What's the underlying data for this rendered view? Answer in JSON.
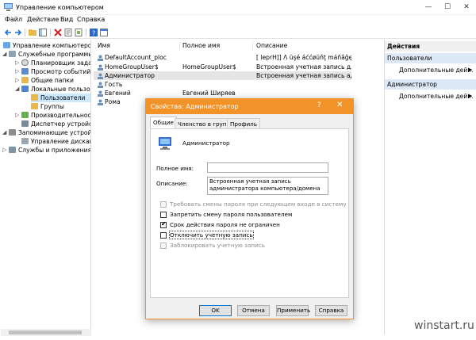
{
  "window": {
    "title": "Управление компьютером",
    "minimize": "—",
    "maximize": "☐",
    "close": "✕"
  },
  "menu": [
    "Файл",
    "Действие",
    "Вид",
    "Справка"
  ],
  "tree": {
    "root": "Управление компьютером (л",
    "items": [
      {
        "label": "Служебные программы"
      },
      {
        "label": "Планировщик заданий"
      },
      {
        "label": "Просмотр событий"
      },
      {
        "label": "Общие папки"
      },
      {
        "label": "Локальные пользовател"
      },
      {
        "label": "Пользователи"
      },
      {
        "label": "Группы"
      },
      {
        "label": "Производительность"
      },
      {
        "label": "Диспетчер устройств"
      },
      {
        "label": "Запоминающие устройств"
      },
      {
        "label": "Управление дисками"
      },
      {
        "label": "Службы и приложения"
      }
    ]
  },
  "list": {
    "columns": [
      "Имя",
      "Полное имя",
      "Описание"
    ],
    "rows": [
      {
        "name": "DefaultAccount_ploc",
        "full": "",
        "desc": "[ leprH]] Λ ŭşé áććøŭňţ máñâĝęď"
      },
      {
        "name": "HomeGroupUser$",
        "full": "HomeGroupUser$",
        "desc": "Встроенная учетная запись для"
      },
      {
        "name": "Администратор",
        "full": "",
        "desc": "Встроенная учетная запись ад"
      },
      {
        "name": "Гость",
        "full": "",
        "desc": ""
      },
      {
        "name": "Евгений",
        "full": "Евгений Ширяев",
        "desc": ""
      },
      {
        "name": "Рома",
        "full": "",
        "desc": ""
      }
    ]
  },
  "actions": {
    "header": "Действия",
    "section1": "Пользователи",
    "item1": "Дополнительные дей...",
    "section2": "Администратор",
    "item2": "Дополнительные дей...",
    "arrow": "▶"
  },
  "dialog": {
    "title": "Свойства: Администратор",
    "help": "?",
    "close": "✕",
    "tabs": [
      "Общие",
      "Членство в группах",
      "Профиль"
    ],
    "user_name": "Администратор",
    "full_name_label": "Полное имя:",
    "full_name_value": "",
    "desc_label": "Описание:",
    "desc_value": "Встроенная учетная запись администратора компьютера/домена",
    "checkboxes": [
      {
        "label": "Требовать смены пароля при следующем входе в систему",
        "checked": false,
        "disabled": true
      },
      {
        "label": "Запретить смену пароля пользователем",
        "checked": false,
        "disabled": false
      },
      {
        "label": "Срок действия пароля не ограничен",
        "checked": true,
        "disabled": false
      },
      {
        "label": "Отключить учетную запись",
        "checked": false,
        "disabled": false
      },
      {
        "label": "Заблокировать учетную запись",
        "checked": false,
        "disabled": true
      }
    ],
    "check_mark": "✔",
    "buttons": {
      "ok": "OK",
      "cancel": "Отмена",
      "apply": "Применить",
      "help": "Справка"
    }
  },
  "watermark": "winstart.ru",
  "colors": {
    "accent": "#f2932a",
    "selection": "#cce8ff",
    "action_header": "#dde9f7"
  }
}
